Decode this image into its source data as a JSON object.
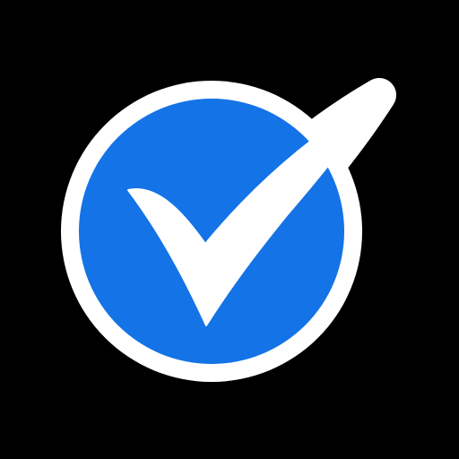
{
  "icon": {
    "name": "checkmark-circle-icon",
    "colors": {
      "background": "#000000",
      "outline": "#ffffff",
      "circle_fill": "#1473e6",
      "checkmark": "#ffffff"
    }
  }
}
